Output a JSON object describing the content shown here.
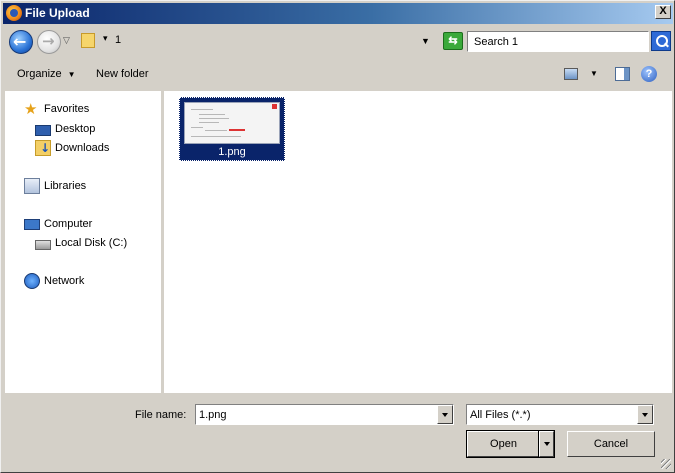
{
  "window": {
    "title": "File Upload",
    "close_label": "X"
  },
  "address_bar": {
    "path": "1",
    "search_placeholder": "Search 1"
  },
  "toolbar": {
    "organize_label": "Organize",
    "new_folder_label": "New folder"
  },
  "nav_pane": {
    "items": [
      {
        "label": "Favorites",
        "icon": "star-icon"
      },
      {
        "label": "Desktop",
        "icon": "desktop-icon"
      },
      {
        "label": "Downloads",
        "icon": "downloads-folder-icon"
      },
      {
        "label": "Libraries",
        "icon": "libraries-icon"
      },
      {
        "label": "Computer",
        "icon": "computer-icon"
      },
      {
        "label": "Local Disk (C:)",
        "icon": "disk-icon"
      },
      {
        "label": "Network",
        "icon": "network-icon"
      }
    ]
  },
  "files": [
    {
      "name": "1.png",
      "selected": true
    }
  ],
  "footer": {
    "file_name_label": "File name:",
    "file_name_value": "1.png",
    "filter_value": "All Files (*.*)",
    "open_label": "Open",
    "cancel_label": "Cancel"
  },
  "colors": {
    "titlebar_start": "#0a246a",
    "titlebar_end": "#a6caf0",
    "selection": "#0a246a",
    "dialog_bg": "#d4d0c8"
  }
}
